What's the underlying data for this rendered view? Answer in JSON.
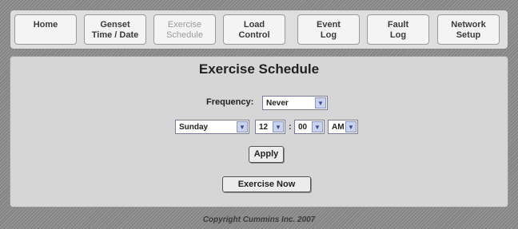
{
  "nav": {
    "tabs": [
      {
        "l1": "Home",
        "l2": ""
      },
      {
        "l1": "Genset",
        "l2": "Time / Date"
      },
      {
        "l1": "Exercise",
        "l2": "Schedule"
      },
      {
        "l1": "Load",
        "l2": "Control"
      },
      {
        "l1": "Event",
        "l2": "Log"
      },
      {
        "l1": "Fault",
        "l2": "Log"
      },
      {
        "l1": "Network",
        "l2": "Setup"
      }
    ],
    "active_index": 2
  },
  "page": {
    "title": "Exercise Schedule",
    "frequency_label": "Frequency:",
    "frequency_value": "Never",
    "day_value": "Sunday",
    "hour_value": "12",
    "minute_value": "00",
    "ampm_value": "AM",
    "time_separator": ":",
    "apply_label": "Apply",
    "exercise_now_label": "Exercise Now"
  },
  "footer": {
    "copyright": "Copyright Cummins Inc. 2007"
  },
  "colors": {
    "background": "#8f8f8f",
    "panel": "#d6d6d6",
    "active_tab_text": "#9a9a9a"
  },
  "icons": {
    "dropdown_arrow": "chevron-down-icon"
  }
}
